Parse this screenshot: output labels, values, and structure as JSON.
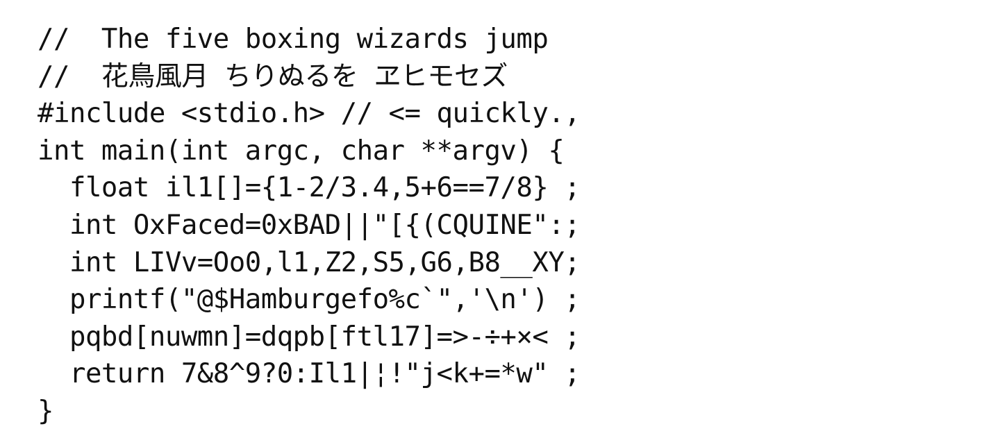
{
  "code": {
    "lines": [
      "//  The five boxing wizards jump",
      "//  花鳥風月 ちりぬるを ヱヒモセズ",
      "#include <stdio.h> // <= quickly.,",
      "int main(int argc, char **argv) {",
      "  float il1[]={1-2/3.4,5+6==7/8} ;",
      "  int OxFaced=0xBAD||\"[{(CQUINE\":;",
      "  int LIVv=Oo0,l1,Z2,S5,G6,B8__XY;",
      "  printf(\"@$Hamburgefo%c`\",'\\n') ;",
      "  pqbd[nuwmn]=dqpb[ftl17]=>-÷+×< ;",
      "  return 7&8^9?0:Il1|¦!\"j<k+=*w\" ;",
      "}"
    ]
  }
}
